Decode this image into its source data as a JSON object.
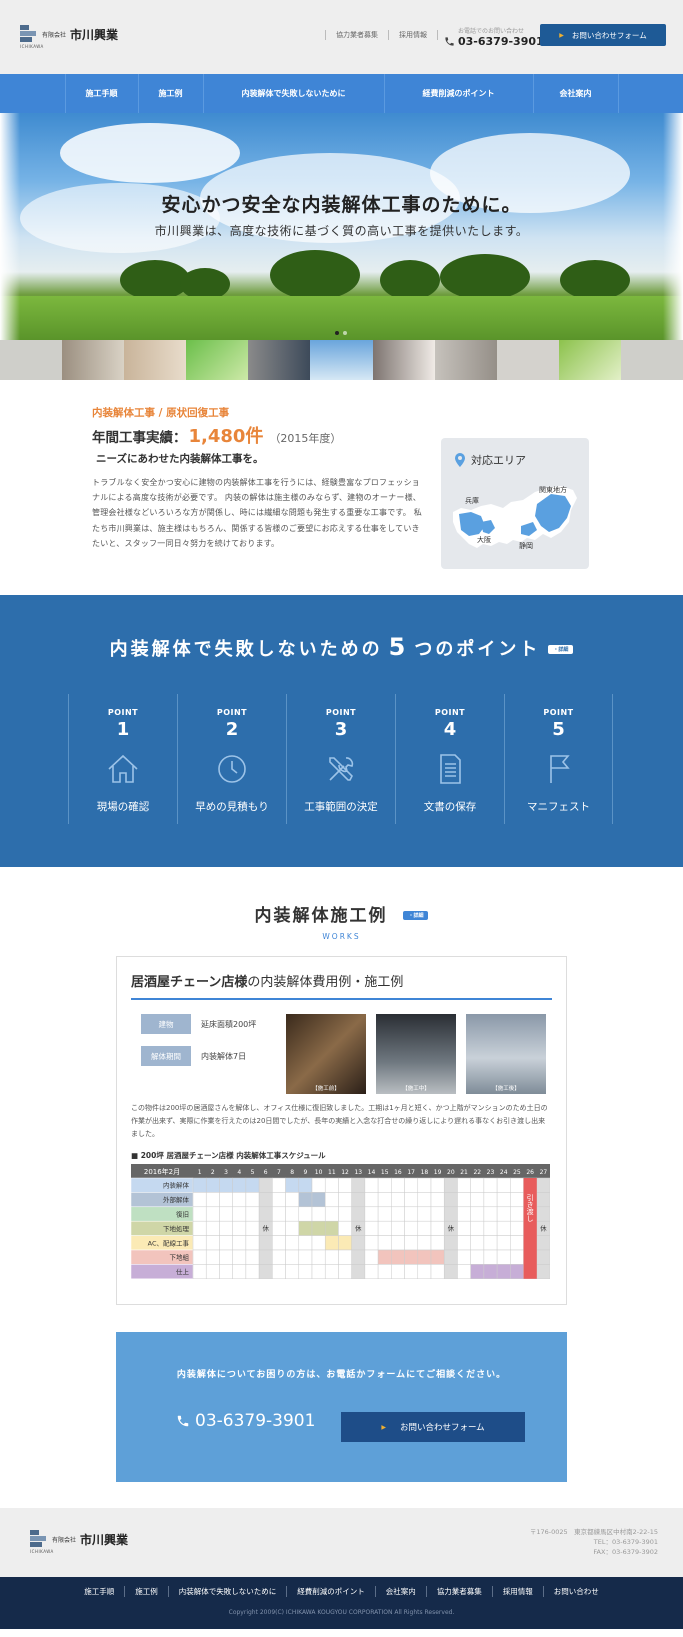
{
  "header": {
    "company_small": "有限会社",
    "company_name": "市川興業",
    "company_roman": "ICHIKAWA",
    "links": [
      "協力業者募集",
      "採用情報"
    ],
    "phone_note": "お電話でのお問い合わせ",
    "phone": "03-6379-3901",
    "cta": "お問い合わせフォーム"
  },
  "nav": [
    "施工手順",
    "施工例",
    "内装解体で失敗しないために",
    "経費削減のポイント",
    "会社案内"
  ],
  "hero": {
    "title": "安心かつ安全な内装解体工事のために。",
    "subtitle": "市川興業は、高度な技術に基づく質の高い工事を提供いたします。"
  },
  "intro": {
    "tag": "内装解体工事 / 原状回復工事",
    "year_label": "年間工事実績：",
    "year_count": "1,480件",
    "year_note": "（2015年度）",
    "lead": "ニーズにあわせた内装解体工事を。",
    "body": "トラブルなく安全かつ安心に建物の内装解体工事を行うには、経験豊富なプロフェッショナルによる高度な技術が必要です。 内装の解体は施主様のみならず、建物のオーナー様、管理会社様などいろいろな方が関係し、時には繊細な問題も発生する重要な工事です。 私たち市川興業は、施主様はもちろん、関係する皆様のご要望にお応えする仕事をしていきたいと、スタッフ一同日々努力を続けております。"
  },
  "area": {
    "title": "対応エリア",
    "labels": [
      "兵庫",
      "関東地方",
      "大阪",
      "静岡"
    ]
  },
  "points": {
    "title_a": "内装解体で失敗しないための",
    "title_num": "5",
    "title_b": "つのポイント",
    "badge": "・詳細",
    "items": [
      {
        "label": "POINT",
        "num": "1",
        "icon": "house-icon",
        "text": "現場の確認"
      },
      {
        "label": "POINT",
        "num": "2",
        "icon": "clock-icon",
        "text": "早めの見積もり"
      },
      {
        "label": "POINT",
        "num": "3",
        "icon": "tools-icon",
        "text": "工事範囲の決定"
      },
      {
        "label": "POINT",
        "num": "4",
        "icon": "document-icon",
        "text": "文書の保存"
      },
      {
        "label": "POINT",
        "num": "5",
        "icon": "flag-icon",
        "text": "マニフェスト"
      }
    ]
  },
  "works": {
    "title": "内装解体施工例",
    "badge": "・詳細",
    "sub": "WORKS",
    "case_bold": "居酒屋チェーン店様",
    "case_rest": "の内装解体費用例・施工例",
    "spec1_label": "建物",
    "spec1_value": "延床面積200坪",
    "spec2_label": "解体期間",
    "spec2_value": "内装解体7日",
    "photos": [
      "【施工前】",
      "【施工中】",
      "【施工後】"
    ],
    "body": "この物件は200坪の居酒屋さんを解体し、オフィス仕様に復旧致しました。工期は1ヶ月と短く、かつ上階がマンションのため土日の作業が出来ず、実際に作業を行えたのは20日間でしたが、長年の実績と入念な打合せの繰り返しにより遅れる事なくお引き渡し出来ました。",
    "sched_title": "■ 200坪 居酒屋チェーン店様 内装解体工事スケジュール",
    "sched_month": "2016年2月",
    "sched_rest": "休",
    "sched_handover": "引き渡し",
    "sched_rows": [
      {
        "name": "内装解体",
        "color": "#c5d9f0",
        "from": 1,
        "to": 5,
        "extra": [
          8,
          9
        ]
      },
      {
        "name": "外部解体",
        "color": "#b3c3d6",
        "from": 9,
        "to": 10,
        "extra": []
      },
      {
        "name": "復旧",
        "color": "#bfe0c2",
        "from": 0,
        "to": 0,
        "extra": []
      },
      {
        "name": "下地処理",
        "color": "#cfd6a7",
        "from": 9,
        "to": 11,
        "extra": []
      },
      {
        "name": "AC、配線工事",
        "color": "#fbeab5",
        "from": 11,
        "to": 12,
        "extra": []
      },
      {
        "name": "下地組",
        "color": "#f2c4bd",
        "from": 15,
        "to": 19,
        "extra": []
      },
      {
        "name": "仕上",
        "color": "#c7aed7",
        "from": 22,
        "to": 25,
        "extra": []
      }
    ]
  },
  "contact": {
    "message": "内装解体についてお困りの方は、お電話かフォームにてご相談ください。",
    "phone": "03-6379-3901",
    "button": "お問い合わせフォーム"
  },
  "footer": {
    "address_lines": [
      "〒176-0025　東京都練馬区中村南2-22-15",
      "TEL：03-6379-3901",
      "FAX：03-6379-3902"
    ],
    "nav": [
      "施工手順",
      "施工例",
      "内装解体で失敗しないために",
      "経費削減のポイント",
      "会社案内",
      "協力業者募集",
      "採用情報",
      "お問い合わせ"
    ],
    "copyright": "Copyright 2009(C) ICHIKAWA KOUGYOU CORPORATION All Rights Reserved."
  },
  "colors": {
    "accent": "#3f85d6",
    "dark_blue": "#1e5a96",
    "points_bg": "#2d6eac",
    "orange": "#e8853a",
    "footer_bg": "#152a4a"
  }
}
